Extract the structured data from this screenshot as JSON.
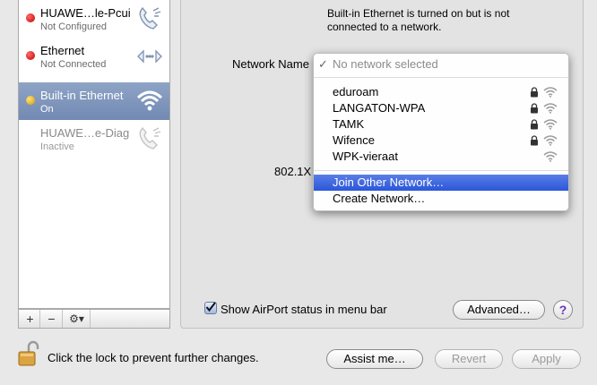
{
  "sidebar": {
    "services": [
      {
        "name": "HUAWE…le-Pcui",
        "status": "Not Configured",
        "dot": "#d40000",
        "icon": "phone-icon"
      },
      {
        "name": "Ethernet",
        "status": "Not Connected",
        "dot": "#d40000",
        "icon": "ethernet-arrows-icon"
      },
      {
        "name": "Built-in Ethernet",
        "status": "On",
        "dot": "#e8a800",
        "icon": "wifi-icon",
        "selected": true
      },
      {
        "name": "HUAWE…e-Diag",
        "status": "Inactive",
        "dot": null,
        "icon": "phone-icon"
      }
    ],
    "bottom": {
      "add": "+",
      "remove": "−",
      "gear": "⚙▾"
    }
  },
  "main": {
    "status_text": "Built-in Ethernet is turned on but is not connected to a network.",
    "network_name_label": "Network Name",
    "label_8021x": "802.1X"
  },
  "menu": {
    "check": "✓",
    "no_network": "No network selected",
    "networks": [
      {
        "name": "eduroam",
        "locked": true
      },
      {
        "name": "LANGATON-WPA",
        "locked": true
      },
      {
        "name": "TAMK",
        "locked": true
      },
      {
        "name": "Wifence",
        "locked": true
      },
      {
        "name": "WPK-vieraat",
        "locked": false
      }
    ],
    "join_other": "Join Other Network…",
    "create": "Create Network…"
  },
  "footer": {
    "show_status_label": "Show AirPort status in menu bar",
    "show_status_checked": true,
    "advanced": "Advanced…",
    "help": "?",
    "lock_text": "Click the lock to prevent further changes.",
    "assist": "Assist me…",
    "revert": "Revert",
    "apply": "Apply"
  }
}
